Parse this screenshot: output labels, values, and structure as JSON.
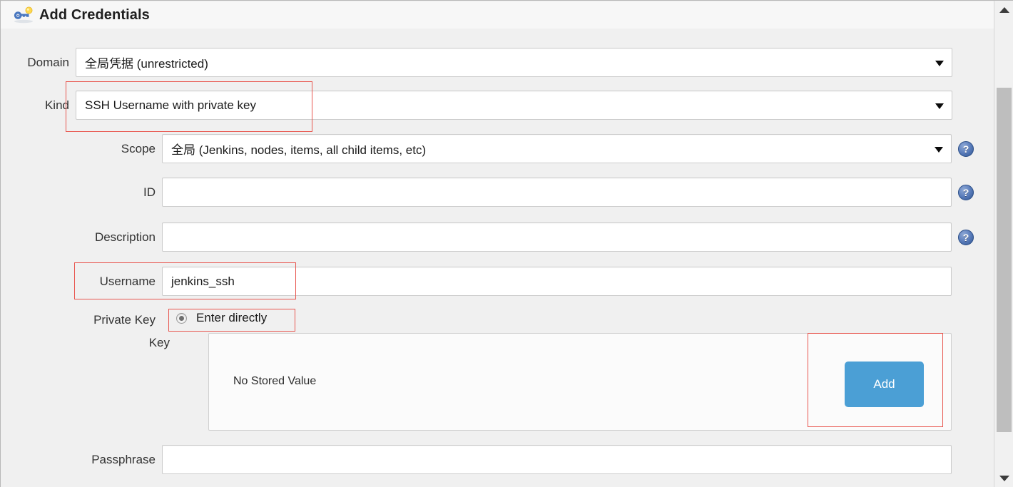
{
  "header": {
    "title": "Add Credentials",
    "icon": "key-icon"
  },
  "form": {
    "domain": {
      "label": "Domain",
      "value": "全局凭据 (unrestricted)",
      "control": "select",
      "icon": "chevron-down-icon"
    },
    "kind": {
      "label": "Kind",
      "value": "SSH Username with private key",
      "control": "select",
      "icon": "chevron-down-icon",
      "highlighted": true
    },
    "scope": {
      "label": "Scope",
      "value": "全局 (Jenkins, nodes, items, all child items, etc)",
      "control": "select",
      "icon": "chevron-down-icon",
      "help_icon": "help-icon",
      "help_glyph": "?"
    },
    "id": {
      "label": "ID",
      "value": "",
      "placeholder": "",
      "control": "text",
      "help_icon": "help-icon",
      "help_glyph": "?"
    },
    "description": {
      "label": "Description",
      "value": "",
      "placeholder": "",
      "control": "text",
      "help_icon": "help-icon",
      "help_glyph": "?"
    },
    "username": {
      "label": "Username",
      "value": "jenkins_ssh",
      "placeholder": "",
      "control": "text",
      "highlighted": true
    },
    "private_key": {
      "label": "Private Key",
      "selected_option": "Enter directly",
      "radio_checked": true,
      "highlighted": true
    },
    "key": {
      "label": "Key",
      "empty_text": "No Stored Value",
      "add_label": "Add",
      "add_highlighted": true
    },
    "passphrase": {
      "label": "Passphrase",
      "value": "",
      "placeholder": "",
      "control": "text"
    }
  },
  "scrollbar": {
    "up_icon": "caret-up-icon",
    "down_icon": "caret-down-icon",
    "thumb": "scrollbar-thumb"
  },
  "colors": {
    "accent_button": "#4b9fd5",
    "highlight_box": "#e8564f",
    "page_background": "#f0f0f0",
    "field_border": "#cccccc"
  }
}
